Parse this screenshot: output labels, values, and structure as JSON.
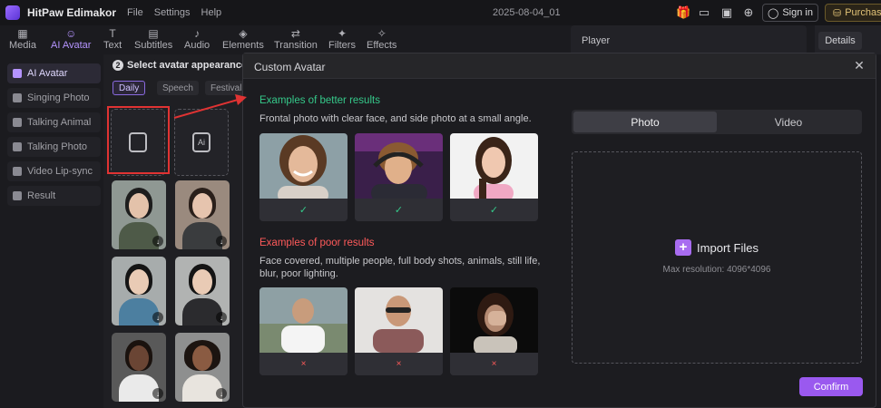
{
  "app": {
    "name": "HitPaw Edimakor",
    "menu": [
      "File",
      "Settings",
      "Help"
    ],
    "document_title": "2025-08-04_01",
    "sign_in_label": "Sign in",
    "purchase_label": "Purchase"
  },
  "toolbar": {
    "items": [
      {
        "label": "Media",
        "icon": "media-icon"
      },
      {
        "label": "AI Avatar",
        "icon": "avatar-icon"
      },
      {
        "label": "Text",
        "icon": "text-icon"
      },
      {
        "label": "Subtitles",
        "icon": "subtitles-icon"
      },
      {
        "label": "Audio",
        "icon": "audio-icon"
      },
      {
        "label": "Elements",
        "icon": "elements-icon"
      },
      {
        "label": "Transition",
        "icon": "transition-icon"
      },
      {
        "label": "Filters",
        "icon": "filters-icon"
      },
      {
        "label": "Effects",
        "icon": "effects-icon"
      }
    ],
    "active": "AI Avatar"
  },
  "player": {
    "label": "Player"
  },
  "details": {
    "label": "Details"
  },
  "sidebar": {
    "items": [
      {
        "label": "AI Avatar"
      },
      {
        "label": "Singing Photo"
      },
      {
        "label": "Talking Animal"
      },
      {
        "label": "Talking Photo"
      },
      {
        "label": "Video Lip-sync"
      },
      {
        "label": "Result"
      }
    ],
    "active": "AI Avatar"
  },
  "avatar_panel": {
    "step_number": "2",
    "step_title": "Select avatar appearance",
    "filters": [
      "Daily",
      "Speech",
      "Festival"
    ],
    "active_filter": "Daily"
  },
  "modal": {
    "title": "Custom Avatar",
    "good_title": "Examples of better results",
    "good_desc": "Frontal photo with clear face, and side photo at a small angle.",
    "good_mark": "✓",
    "bad_title": "Examples of poor results",
    "bad_desc_line1": "Face covered, multiple people, full body shots, animals, still life,",
    "bad_desc_line2": "blur, poor lighting.",
    "bad_mark": "×",
    "tabs": [
      "Photo",
      "Video"
    ],
    "active_tab": "Photo",
    "import_label": "Import Files",
    "max_resolution": "Max resolution: 4096*4096",
    "confirm_label": "Confirm"
  },
  "colors": {
    "accent": "#9a59ef",
    "good": "#35c98a",
    "bad": "#ff5a5a",
    "highlight": "#e03333"
  }
}
